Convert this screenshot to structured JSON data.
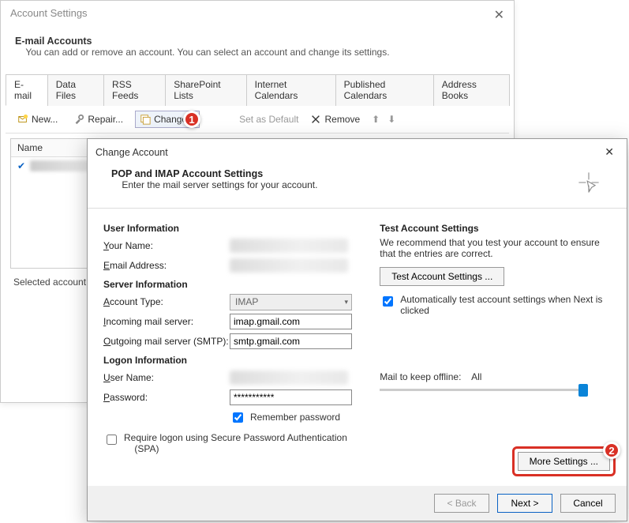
{
  "back": {
    "title": "Account Settings",
    "heading": "E-mail Accounts",
    "subhead": "You can add or remove an account. You can select an account and change its settings.",
    "tabs": [
      "E-mail",
      "Data Files",
      "RSS Feeds",
      "SharePoint Lists",
      "Internet Calendars",
      "Published Calendars",
      "Address Books"
    ],
    "toolbar": {
      "new": "New...",
      "repair": "Repair...",
      "change": "Change...",
      "set_default": "Set as Default",
      "remove": "Remove"
    },
    "list": {
      "col_name": "Name"
    },
    "selected_label": "Selected account de"
  },
  "callouts": {
    "one": "1",
    "two": "2"
  },
  "dlg": {
    "title": "Change Account",
    "head": "POP and IMAP Account Settings",
    "head_sub": "Enter the mail server settings for your account.",
    "user_info": "User Information",
    "your_name": "Your Name:",
    "email": "Email Address:",
    "server_info": "Server Information",
    "acct_type": "Account Type:",
    "acct_type_val": "IMAP",
    "incoming": "Incoming mail server:",
    "incoming_val": "imap.gmail.com",
    "outgoing": "Outgoing mail server (SMTP):",
    "outgoing_val": "smtp.gmail.com",
    "logon": "Logon Information",
    "username": "User Name:",
    "password": "Password:",
    "password_val": "***********",
    "remember": "Remember password",
    "spa": "Require logon using Secure Password Authentication (SPA)",
    "test_head": "Test Account Settings",
    "test_desc": "We recommend that you test your account to ensure that the entries are correct.",
    "test_btn": "Test Account Settings ...",
    "auto_test": "Automatically test account settings when Next is clicked",
    "mail_keep": "Mail to keep offline:",
    "mail_keep_val": "All",
    "more": "More Settings ...",
    "back": "< Back",
    "next": "Next >",
    "cancel": "Cancel"
  }
}
